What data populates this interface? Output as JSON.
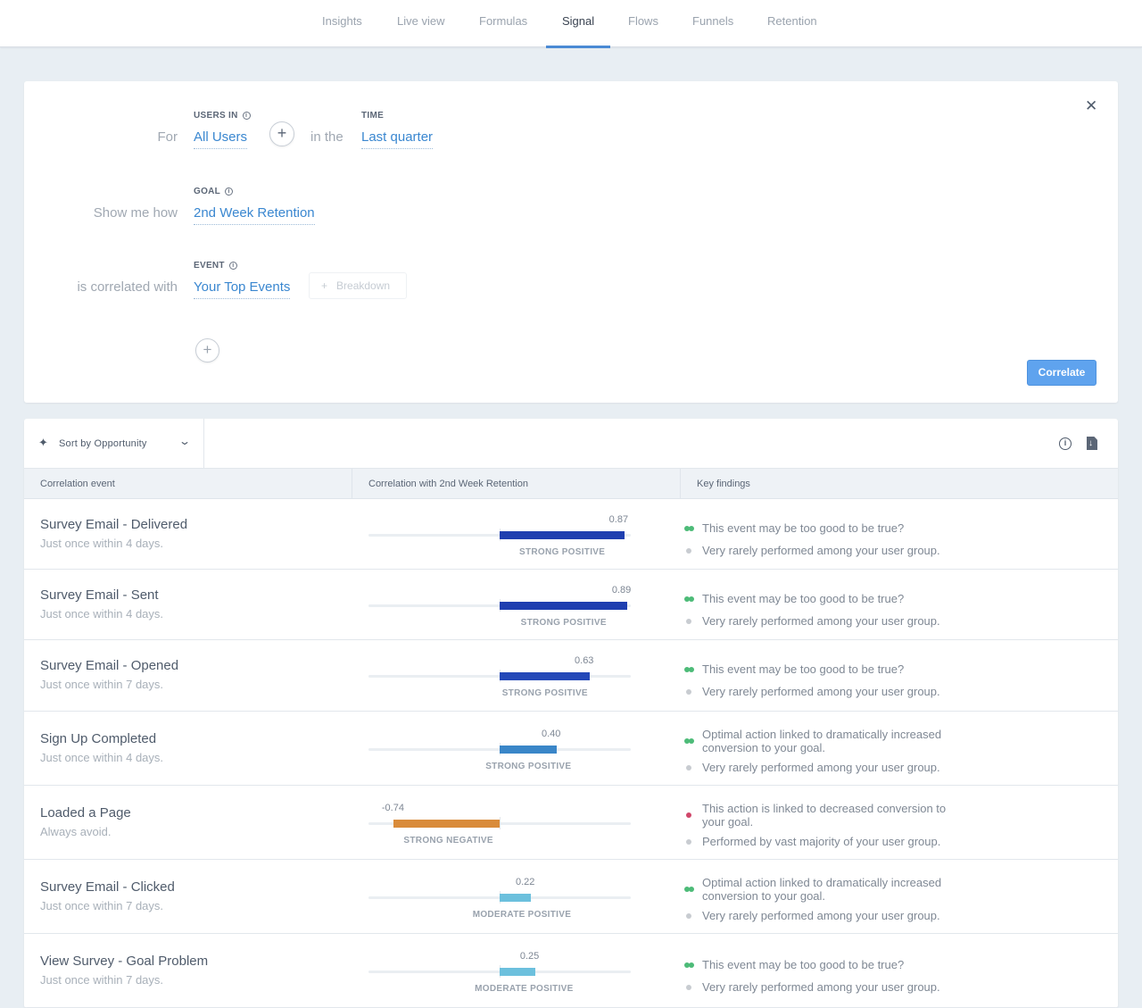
{
  "nav": {
    "tabs": [
      {
        "label": "Insights",
        "active": false
      },
      {
        "label": "Live view",
        "active": false
      },
      {
        "label": "Formulas",
        "active": false
      },
      {
        "label": "Signal",
        "active": true
      },
      {
        "label": "Flows",
        "active": false
      },
      {
        "label": "Funnels",
        "active": false
      },
      {
        "label": "Retention",
        "active": false
      }
    ]
  },
  "query": {
    "for_label": "For",
    "users_in_caption": "USERS IN",
    "users_in_value": "All Users",
    "in_the_label": "in the",
    "time_caption": "TIME",
    "time_value": "Last quarter",
    "show_me_label": "Show me how",
    "goal_caption": "GOAL",
    "goal_value": "2nd Week Retention",
    "correlated_label": "is correlated with",
    "event_caption": "EVENT",
    "event_value": "Your Top Events",
    "breakdown_label": "Breakdown",
    "plus_glyph": "+",
    "info_glyph": "i",
    "close_glyph": "✕",
    "correlate_label": "Correlate"
  },
  "results": {
    "sort_label": "Sort by Opportunity",
    "sort_icon": "✦",
    "chevron": "⌄",
    "info_glyph": "i",
    "columns": [
      "Correlation event",
      "Correlation with 2nd Week Retention",
      "Key findings"
    ],
    "colors": {
      "strong_positive_dark": "#1f3fb0",
      "strong_positive_mid": "#3a86c8",
      "moderate_positive": "#6cc0dd",
      "strong_negative": "#d98b3a",
      "finding_green": "#4dbb78",
      "finding_red": "#d0476a",
      "finding_gray": "#c8ccd1"
    },
    "rows": [
      {
        "name": "Survey Email - Delivered",
        "sub": "Just once within 4 days.",
        "value": 0.87,
        "value_label": "0.87",
        "strength": "STRONG POSITIVE",
        "color": "#1f3fb0",
        "findings": [
          {
            "type": "green",
            "text": "This event may be too good to be true?"
          },
          {
            "type": "gray",
            "text": "Very rarely performed among your user group."
          }
        ]
      },
      {
        "name": "Survey Email - Sent",
        "sub": "Just once within 4 days.",
        "value": 0.89,
        "value_label": "0.89",
        "strength": "STRONG POSITIVE",
        "color": "#1f3fb0",
        "findings": [
          {
            "type": "green",
            "text": "This event may be too good to be true?"
          },
          {
            "type": "gray",
            "text": "Very rarely performed among your user group."
          }
        ]
      },
      {
        "name": "Survey Email - Opened",
        "sub": "Just once within 7 days.",
        "value": 0.63,
        "value_label": "0.63",
        "strength": "STRONG POSITIVE",
        "color": "#2348b8",
        "findings": [
          {
            "type": "green",
            "text": "This event may be too good to be true?"
          },
          {
            "type": "gray",
            "text": "Very rarely performed among your user group."
          }
        ]
      },
      {
        "name": "Sign Up Completed",
        "sub": "Just once within 4 days.",
        "value": 0.4,
        "value_label": "0.40",
        "strength": "STRONG POSITIVE",
        "color": "#3a86c8",
        "findings": [
          {
            "type": "green",
            "text": "Optimal action linked to dramatically increased conversion to your goal."
          },
          {
            "type": "gray",
            "text": "Very rarely performed among your user group."
          }
        ]
      },
      {
        "name": "Loaded a Page",
        "sub": "Always avoid.",
        "value": -0.74,
        "value_label": "-0.74",
        "strength": "STRONG NEGATIVE",
        "color": "#d98b3a",
        "findings": [
          {
            "type": "red",
            "text": "This action is linked to decreased conversion to your goal."
          },
          {
            "type": "gray",
            "text": "Performed by vast majority of your user group."
          }
        ]
      },
      {
        "name": "Survey Email - Clicked",
        "sub": "Just once within 7 days.",
        "value": 0.22,
        "value_label": "0.22",
        "strength": "MODERATE POSITIVE",
        "color": "#6cc0dd",
        "findings": [
          {
            "type": "green",
            "text": "Optimal action linked to dramatically increased conversion to your goal."
          },
          {
            "type": "gray",
            "text": "Very rarely performed among your user group."
          }
        ]
      },
      {
        "name": "View Survey - Goal Problem",
        "sub": "Just once within 7 days.",
        "value": 0.25,
        "value_label": "0.25",
        "strength": "MODERATE POSITIVE",
        "color": "#6cc0dd",
        "findings": [
          {
            "type": "green",
            "text": "This event may be too good to be true?"
          },
          {
            "type": "gray",
            "text": "Very rarely performed among your user group."
          }
        ]
      }
    ]
  }
}
